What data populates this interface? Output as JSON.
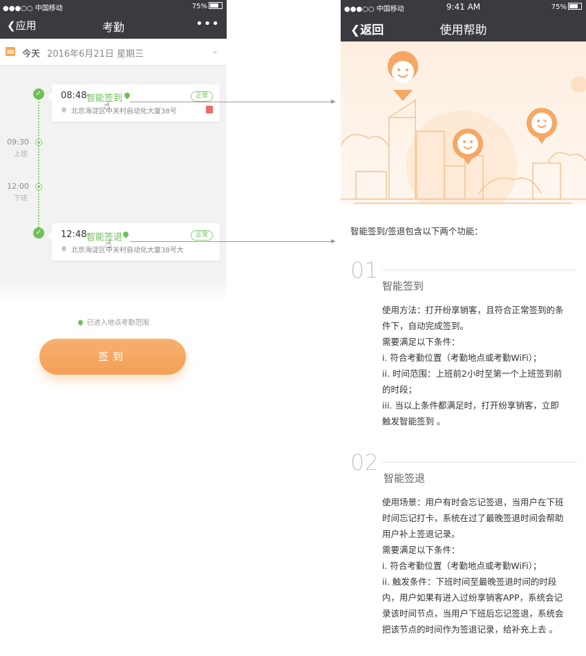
{
  "left": {
    "status": {
      "carrier": "●●●○○ 中国移动",
      "battery": "75%"
    },
    "nav": {
      "back": "应用",
      "title": "考勤",
      "more": "•••"
    },
    "datebar": {
      "today": "今天",
      "date": "2016年6月21日 星期三"
    },
    "timeline": {
      "t1": {
        "time": "09:30",
        "label": "上班"
      },
      "t2": {
        "time": "12:00",
        "label": "下班"
      }
    },
    "cards": [
      {
        "time": "08:48",
        "action": "智能签到",
        "badge": "正常",
        "address": "北京海淀区中关村自动化大厦38号"
      },
      {
        "time": "12:48",
        "action": "智能签退",
        "badge": "正常",
        "address": "北京海淀区中关村自动化大厦38号大"
      }
    ],
    "range_tip": "已进入地点考勤范围",
    "signin_button": "签到"
  },
  "right": {
    "status": {
      "carrier": "●●●○○ 中国移动",
      "time": "9:41 AM",
      "battery": "75%"
    },
    "nav": {
      "back": "返回",
      "title": "使用帮助"
    },
    "intro": "智能签到/签退包含以下两个功能：",
    "sections": [
      {
        "num": "01",
        "title": "智能签到",
        "lines": [
          "使用方法：打开纷享销客，且符合正常签到的条",
          "件下，自动完成签到。",
          "需要满足以下条件：",
          "i. 符合考勤位置（考勤地点或考勤WiFi）；",
          "ii. 时间范围：上班前2小时至第一个上班签到前",
          "的时段；",
          "iii. 当以上条件都满足时，打开纷享销客，立即",
          "触发智能签到 。"
        ]
      },
      {
        "num": "02",
        "title": "智能签退",
        "lines": [
          "使用场景：用户有时会忘记签退，当用户在下班",
          "时间忘记打卡，系统在过了最晚签退时间会帮助",
          "用户补上签退记录。",
          "需要满足以下条件：",
          "i. 符合考勤位置（考勤地点或考勤WiFi）；",
          "ii. 触发条件：下班时间至最晚签退时间的时段",
          "内，用户如果有进入过纷享销客APP，系统会记",
          "录该时间节点，当用户下班后忘记签退，系统会",
          "把该节点的时间作为签退记录，给补充上去 。"
        ]
      }
    ]
  },
  "colors": {
    "nav_bg": "#3a3a40",
    "accent_green": "#6fbf58",
    "accent_orange": "#f3a057"
  }
}
